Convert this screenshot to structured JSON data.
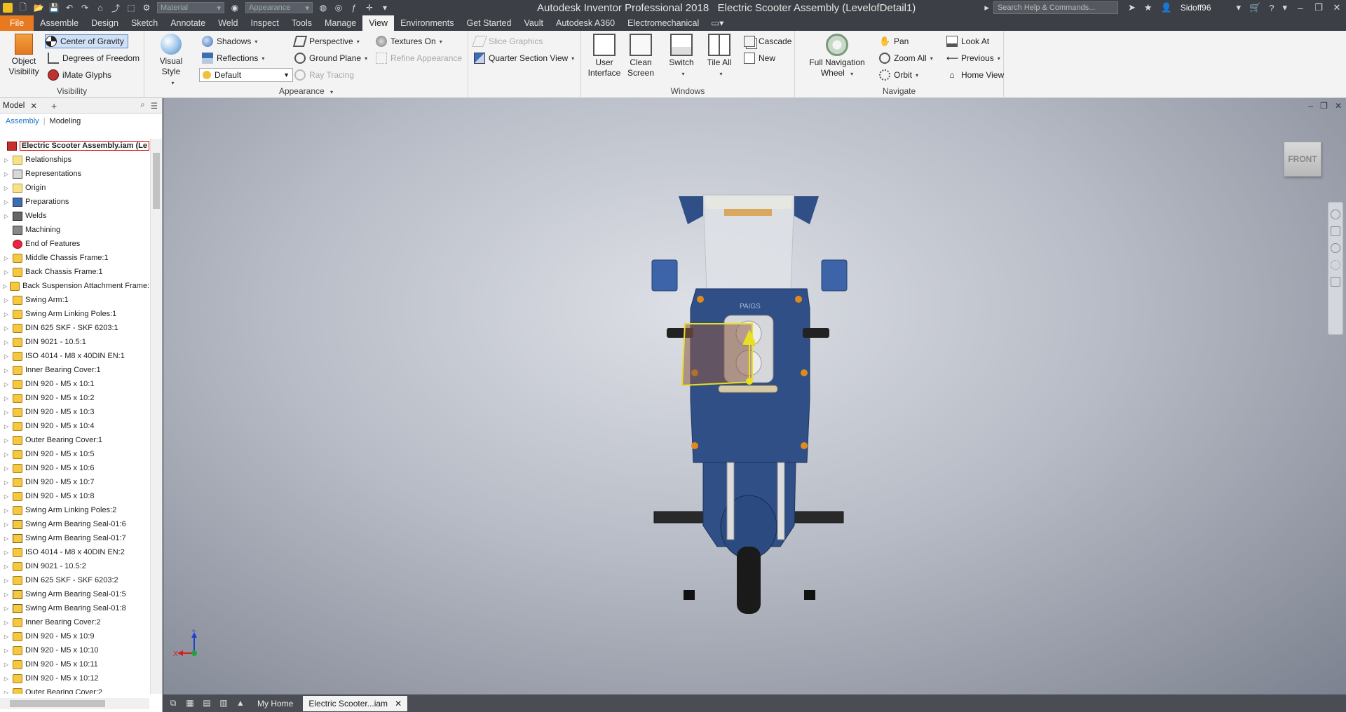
{
  "titlebar": {
    "app_title": "Autodesk Inventor Professional 2018",
    "doc_title": "Electric Scooter Assembly (LevelofDetail1)",
    "material_placeholder": "Material",
    "appearance_placeholder": "Appearance",
    "search_placeholder": "Search Help & Commands...",
    "user": "Sidoff96"
  },
  "tabs": [
    "File",
    "Assemble",
    "Design",
    "Sketch",
    "Annotate",
    "Weld",
    "Inspect",
    "Tools",
    "Manage",
    "View",
    "Environments",
    "Get Started",
    "Vault",
    "Autodesk A360",
    "Electromechanical"
  ],
  "active_tab": "View",
  "ribbon": {
    "visibility": {
      "label": "Visibility",
      "object_visibility": "Object Visibility",
      "center_of_gravity": "Center of Gravity",
      "degrees_of_freedom": "Degrees of Freedom",
      "imate_glyphs": "iMate Glyphs"
    },
    "appearance": {
      "label": "Appearance",
      "visual_style": "Visual Style",
      "shadows": "Shadows",
      "reflections": "Reflections",
      "default": "Default",
      "perspective": "Perspective",
      "ground_plane": "Ground Plane",
      "ray_tracing": "Ray Tracing",
      "textures_on": "Textures On",
      "refine_appearance": "Refine Appearance",
      "slice_graphics": "Slice Graphics",
      "quarter_section_view": "Quarter Section View"
    },
    "windows": {
      "label": "Windows",
      "user_interface": "User Interface",
      "clean_screen": "Clean Screen",
      "switch": "Switch",
      "tile_all": "Tile All",
      "cascade": "Cascade",
      "new": "New"
    },
    "navigate": {
      "label": "Navigate",
      "full_navigation_wheel": "Full Navigation Wheel",
      "pan": "Pan",
      "zoom_all": "Zoom All",
      "orbit": "Orbit",
      "look_at": "Look At",
      "previous": "Previous",
      "home_view": "Home View"
    }
  },
  "browser": {
    "tab": "Model",
    "subtab_assembly": "Assembly",
    "subtab_modeling": "Modeling",
    "root": "Electric Scooter Assembly.iam (Le",
    "items": [
      {
        "label": "Relationships",
        "icon": "folder"
      },
      {
        "label": "Representations",
        "icon": "rep"
      },
      {
        "label": "Origin",
        "icon": "folder"
      },
      {
        "label": "Preparations",
        "icon": "prep"
      },
      {
        "label": "Welds",
        "icon": "weld"
      },
      {
        "label": "Machining",
        "icon": "mach"
      },
      {
        "label": "End of Features",
        "icon": "end"
      },
      {
        "label": "Middle Chassis Frame:1",
        "icon": "part"
      },
      {
        "label": "Back Chassis Frame:1",
        "icon": "part"
      },
      {
        "label": "Back Suspension Attachment Frame:",
        "icon": "part"
      },
      {
        "label": "Swing Arm:1",
        "icon": "part"
      },
      {
        "label": "Swing Arm Linking Poles:1",
        "icon": "part"
      },
      {
        "label": "DIN 625 SKF - SKF 6203:1",
        "icon": "part"
      },
      {
        "label": "DIN 9021 - 10.5:1",
        "icon": "part"
      },
      {
        "label": "ISO 4014 - M8 x 40DIN EN:1",
        "icon": "part"
      },
      {
        "label": "Inner Bearing  Cover:1",
        "icon": "part"
      },
      {
        "label": "DIN 920 - M5 x 10:1",
        "icon": "part"
      },
      {
        "label": "DIN 920 - M5 x 10:2",
        "icon": "part"
      },
      {
        "label": "DIN 920 - M5 x 10:3",
        "icon": "part"
      },
      {
        "label": "DIN 920 - M5 x 10:4",
        "icon": "part"
      },
      {
        "label": "Outer Bearing Cover:1",
        "icon": "part"
      },
      {
        "label": "DIN 920 - M5 x 10:5",
        "icon": "part"
      },
      {
        "label": "DIN 920 - M5 x 10:6",
        "icon": "part"
      },
      {
        "label": "DIN 920 - M5 x 10:7",
        "icon": "part"
      },
      {
        "label": "DIN 920 - M5 x 10:8",
        "icon": "part"
      },
      {
        "label": "Swing Arm Linking Poles:2",
        "icon": "part"
      },
      {
        "label": "Swing Arm Bearing Seal-01:6",
        "icon": "sub"
      },
      {
        "label": "Swing Arm Bearing Seal-01:7",
        "icon": "sub"
      },
      {
        "label": "ISO 4014 - M8 x 40DIN EN:2",
        "icon": "part"
      },
      {
        "label": "DIN 9021 - 10.5:2",
        "icon": "part"
      },
      {
        "label": "DIN 625 SKF - SKF 6203:2",
        "icon": "part"
      },
      {
        "label": "Swing Arm Bearing Seal-01:5",
        "icon": "sub"
      },
      {
        "label": "Swing Arm Bearing Seal-01:8",
        "icon": "sub"
      },
      {
        "label": "Inner Bearing  Cover:2",
        "icon": "part"
      },
      {
        "label": "DIN 920 - M5 x 10:9",
        "icon": "part"
      },
      {
        "label": "DIN 920 - M5 x 10:10",
        "icon": "part"
      },
      {
        "label": "DIN 920 - M5 x 10:11",
        "icon": "part"
      },
      {
        "label": "DIN 920 - M5 x 10:12",
        "icon": "part"
      },
      {
        "label": "Outer Bearing Cover:2",
        "icon": "part"
      }
    ]
  },
  "viewport": {
    "viewcube_label": "FRONT",
    "triad_x": "X",
    "triad_z": "Z",
    "scooter_brand": "PAIGS"
  },
  "bottom": {
    "my_home": "My Home",
    "doc_tab": "Electric Scooter...iam"
  },
  "colors": {
    "file_tab": "#e8791f",
    "frame_blue": "#2f4f86",
    "cog_highlight": "#cfe0f6"
  }
}
